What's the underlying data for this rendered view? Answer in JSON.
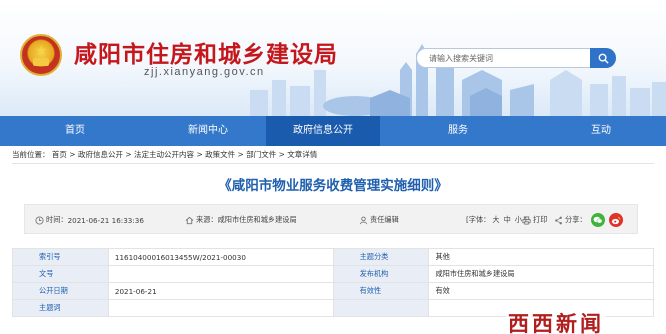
{
  "site": {
    "title": "咸阳市住房和城乡建设局",
    "url": "zjj.xianyang.gov.cn"
  },
  "search": {
    "placeholder": "请输入搜索关键词",
    "icon": "search-icon"
  },
  "nav": {
    "items": [
      {
        "label": "首页"
      },
      {
        "label": "新闻中心"
      },
      {
        "label": "政府信息公开",
        "active": true
      },
      {
        "label": "服务"
      },
      {
        "label": "互动"
      }
    ]
  },
  "breadcrumb": {
    "prefix": "当前位置：",
    "items": [
      "首页",
      "政府信息公开",
      "法定主动公开内容",
      "政策文件",
      "部门文件",
      "文章详情"
    ],
    "separator": ">"
  },
  "article": {
    "title": "《咸阳市物业服务收费管理实施细则》"
  },
  "infobar": {
    "time_label": "时间：",
    "time_value": "2021-06-21 16:33:36",
    "source_label": "来源：",
    "source_value": "咸阳市住房和城乡建设局",
    "editor_label": "责任编辑",
    "font_label": "[字体：",
    "font_large": "大",
    "font_medium": "中",
    "font_small": "小",
    "font_close": "]",
    "print_label": "打印",
    "share_label": "分享："
  },
  "meta": {
    "rows": [
      {
        "l1": "索引号",
        "v1": "11610400016013455W/2021-00030",
        "l2": "主题分类",
        "v2": "其他"
      },
      {
        "l1": "文号",
        "v1": "",
        "l2": "发布机构",
        "v2": "咸阳市住房和城乡建设局"
      },
      {
        "l1": "公开日期",
        "v1": "2021-06-21",
        "l2": "有效性",
        "v2": "有效"
      },
      {
        "l1": "主题词",
        "v1": "",
        "l2": "",
        "v2": ""
      }
    ]
  },
  "watermark": "西西新闻",
  "colors": {
    "brand_red": "#c4171c",
    "nav_blue": "#3478cb",
    "nav_active": "#1a5bad",
    "title_blue": "#1f5fae"
  }
}
